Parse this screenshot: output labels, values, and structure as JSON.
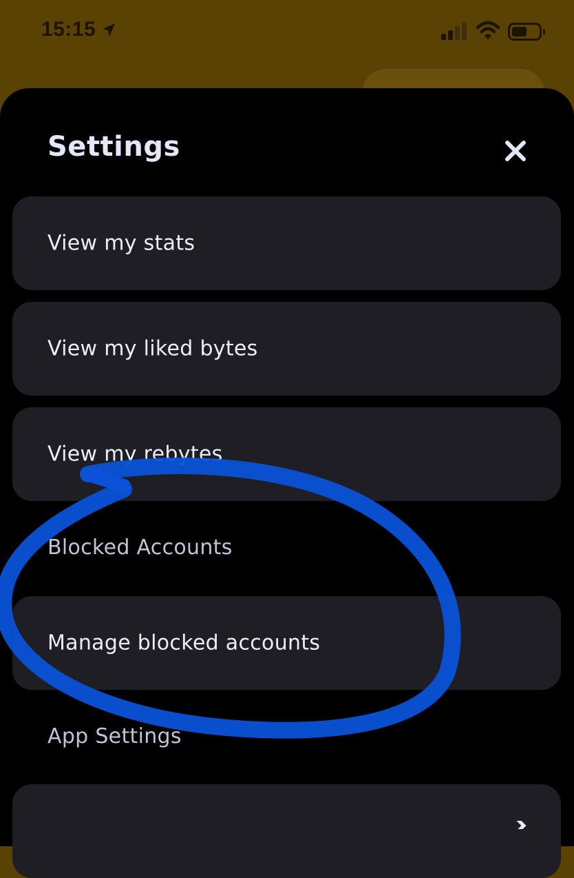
{
  "status_bar": {
    "time": "15:15"
  },
  "sheet": {
    "title": "Settings",
    "items": [
      {
        "label": "View my stats"
      },
      {
        "label": "View my liked bytes"
      },
      {
        "label": "View my rebytes"
      }
    ],
    "blocked_section": {
      "header": "Blocked Accounts",
      "items": [
        {
          "label": "Manage blocked accounts"
        }
      ]
    },
    "app_section": {
      "header": "App Settings",
      "items": [
        {
          "label": ""
        }
      ]
    }
  },
  "colors": {
    "backdrop": "#5a4104",
    "sheet": "#000000",
    "card": "#1e1e24",
    "annotation": "#0a52d8"
  },
  "icons": [
    "location-arrow-icon",
    "cellular-signal-icon",
    "wifi-icon",
    "battery-icon",
    "close-icon",
    "chevron-right-icon"
  ]
}
